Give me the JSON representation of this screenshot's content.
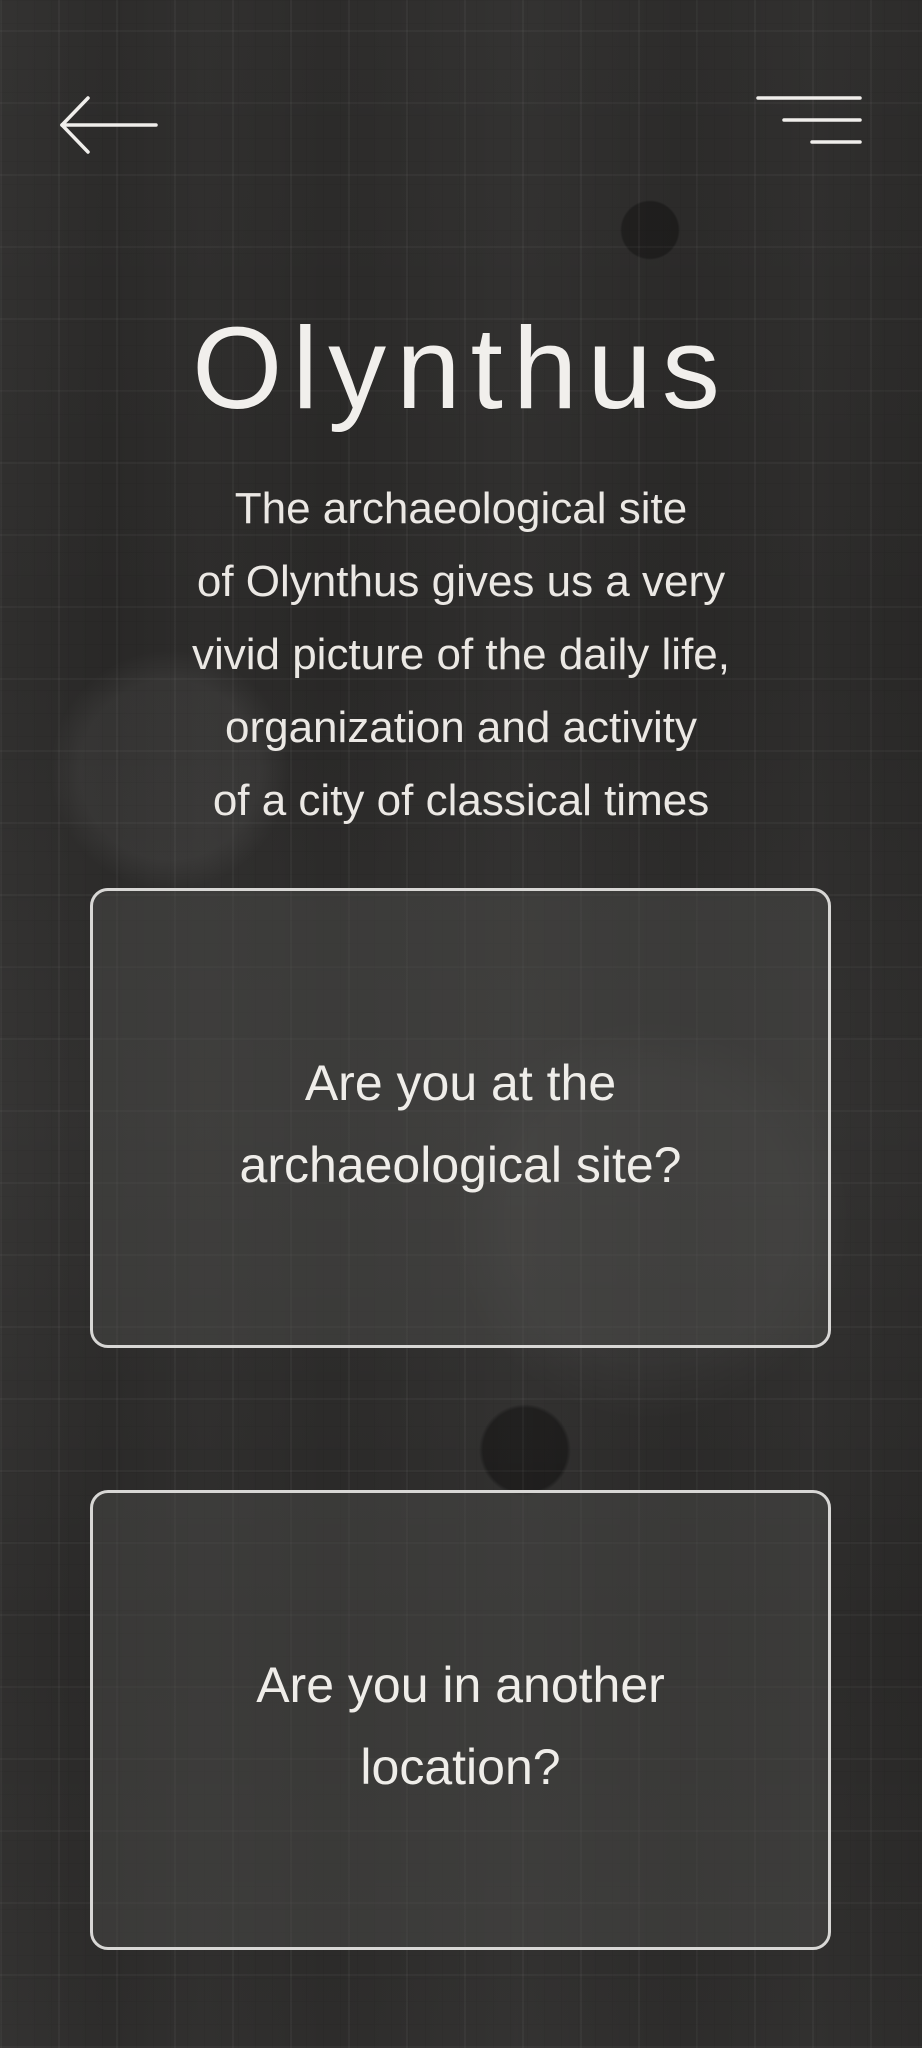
{
  "header": {
    "back_icon": "arrow-left-icon",
    "menu_icon": "menu-lines-icon"
  },
  "page": {
    "title": "Olynthus",
    "description": "The archaeological site\nof Olynthus gives us a very\nvivid picture of the daily life,\norganization and activity\nof a city of classical times"
  },
  "options": [
    {
      "label": "Are you at the\narchaeological site?"
    },
    {
      "label": "Are you in another\nlocation?"
    }
  ],
  "colors": {
    "text": "#EFEDE9",
    "card_border": "#D8D7D5",
    "background": "#2A2928"
  }
}
